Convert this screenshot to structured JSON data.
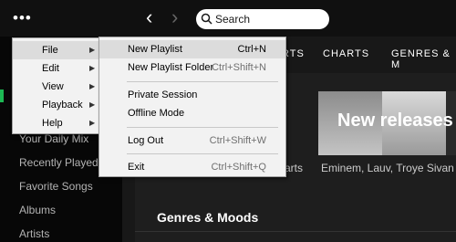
{
  "topbar": {
    "more_dots": "•••",
    "back_arrow": "‹",
    "forward_arrow": "›",
    "search_placeholder": "Search"
  },
  "tabs": [
    "RTS",
    "CHARTS",
    "GENRES & M"
  ],
  "sidebar": {
    "items": [
      "Your Daily Mix",
      "Recently Played",
      "Favorite Songs",
      "Albums",
      "Artists"
    ]
  },
  "main": {
    "new_releases": "New releases",
    "left_caption": "arts",
    "right_caption": "Eminem, Lauv, Troye Sivan",
    "section_title": "Genres & Moods"
  },
  "app_menu": {
    "items": [
      {
        "label": "File",
        "arrow": "▶"
      },
      {
        "label": "Edit",
        "arrow": "▶"
      },
      {
        "label": "View",
        "arrow": "▶"
      },
      {
        "label": "Playback",
        "arrow": "▶"
      },
      {
        "label": "Help",
        "arrow": "▶"
      }
    ]
  },
  "file_menu": {
    "items": [
      {
        "label": "New Playlist",
        "shortcut": "Ctrl+N"
      },
      {
        "label": "New Playlist Folder",
        "shortcut": "Ctrl+Shift+N"
      },
      {
        "label": "Private Session",
        "shortcut": ""
      },
      {
        "label": "Offline Mode",
        "shortcut": ""
      },
      {
        "label": "Log Out",
        "shortcut": "Ctrl+Shift+W"
      },
      {
        "label": "Exit",
        "shortcut": "Ctrl+Shift+Q"
      }
    ]
  },
  "colors": {
    "accent": "#1db954",
    "menu_bg": "#f2f2f2",
    "menu_highlight": "#dcdcdc"
  }
}
